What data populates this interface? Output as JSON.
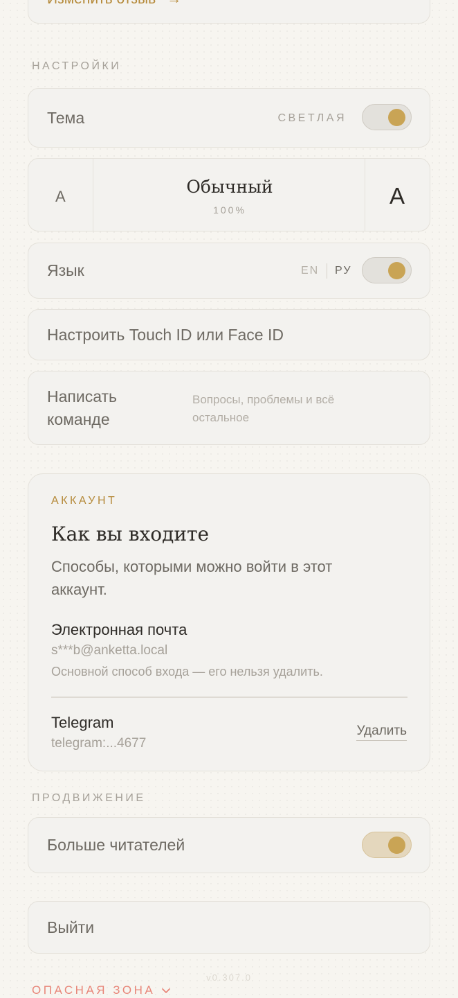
{
  "top": {
    "edit_review_label": "Изменить отзыв",
    "arrow": "→"
  },
  "settings": {
    "section_label": "НАСТРОЙКИ",
    "theme": {
      "label": "Тема",
      "value": "СВЕТЛАЯ",
      "toggle_on": true
    },
    "font_size": {
      "small_label": "A",
      "large_label": "A",
      "current_name": "Обычный",
      "current_percent": "100%"
    },
    "language": {
      "label": "Язык",
      "option_en": "EN",
      "option_ru": "РУ",
      "toggle_on": true
    },
    "biometrics_label": "Настроить Touch ID или Face ID",
    "contact": {
      "label": "Написать команде",
      "description": "Вопросы, проблемы и всё остальное"
    }
  },
  "account": {
    "section_label": "АККАУНТ",
    "title": "Как вы входите",
    "subtitle": "Способы, которыми можно войти в этот аккаунт.",
    "email": {
      "title": "Электронная почта",
      "value": "s***b@anketta.local",
      "note": "Основной способ входа — его нельзя удалить."
    },
    "telegram": {
      "title": "Telegram",
      "value": "telegram:...4677",
      "remove_label": "Удалить"
    }
  },
  "promotion": {
    "section_label": "ПРОДВИЖЕНИЕ",
    "more_readers_label": "Больше читателей",
    "toggle_on": true
  },
  "logout_label": "Выйти",
  "version": "v0.307.0",
  "danger_zone": {
    "label": "ОПАСНАЯ ЗОНА"
  },
  "colors": {
    "accent_gold": "#c9a455",
    "danger": "#e8877a",
    "background": "#f7f5f0"
  }
}
